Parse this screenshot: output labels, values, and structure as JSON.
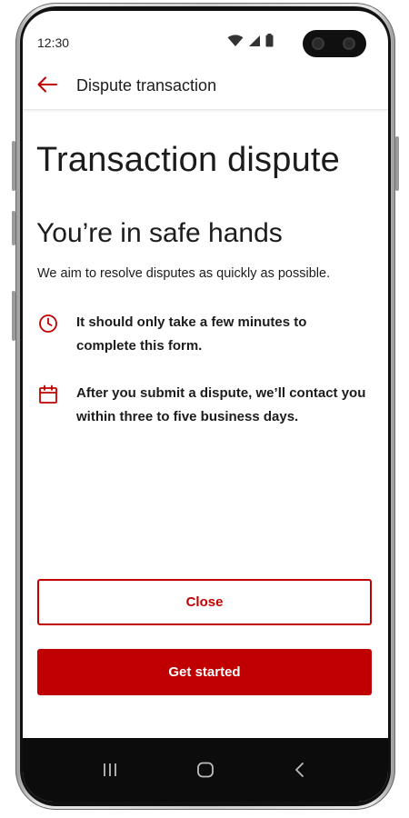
{
  "status_bar": {
    "time": "12:30",
    "icons": [
      "wifi-icon",
      "signal-icon",
      "battery-icon"
    ]
  },
  "app_bar": {
    "back_icon": "arrow-left-icon",
    "title": "Dispute transaction"
  },
  "main": {
    "page_title": "Transaction dispute",
    "section_title": "You’re in safe hands",
    "intro": "We aim to resolve disputes as quickly as possible.",
    "info_items": [
      {
        "icon": "clock-icon",
        "text": "It should only take a few minutes to complete this form."
      },
      {
        "icon": "calendar-icon",
        "text": "After you submit a dispute, we’ll contact you within three to five business days."
      }
    ]
  },
  "actions": {
    "close_label": "Close",
    "get_started_label": "Get started"
  },
  "nav_bar": {
    "icons": [
      "recent-apps-icon",
      "home-icon",
      "back-icon"
    ]
  },
  "colors": {
    "accent": "#c00000",
    "text": "#1c1c1c",
    "nav_background": "#0c0c0c"
  }
}
